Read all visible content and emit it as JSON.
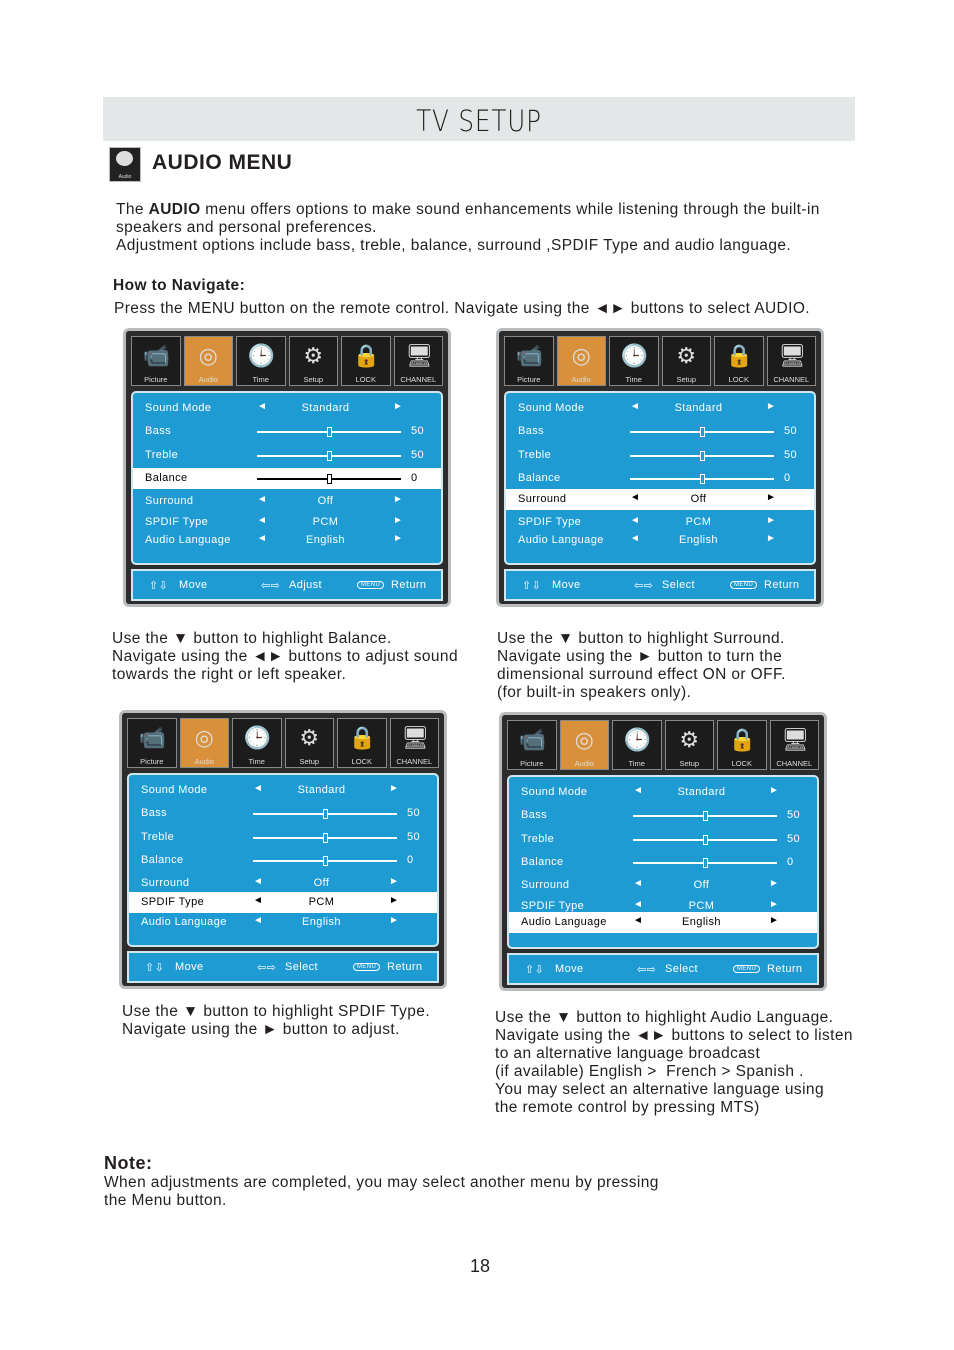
{
  "header": {
    "title": "TV SETUP"
  },
  "section": {
    "icon_label": "Audio",
    "title": "AUDIO MENU"
  },
  "intro": {
    "p1_pre": "The ",
    "p1_bold": "AUDIO",
    "p1_post": " menu offers options to make sound enhancements while listening through the built-in",
    "p1_line2": "speakers and personal preferences.",
    "p2": "Adjustment options include bass, treble, balance, surround ,SPDIF Type and audio language."
  },
  "navigate": {
    "heading": "How to Navigate:",
    "text": "Press the MENU button on the remote control. Navigate using the ◄► buttons to select AUDIO."
  },
  "tabs": [
    {
      "label": "Picture",
      "icon": "camera-icon"
    },
    {
      "label": "Audio",
      "icon": "satellite-dish-icon"
    },
    {
      "label": "Time",
      "icon": "clock-icon"
    },
    {
      "label": "Setup",
      "icon": "gear-icon"
    },
    {
      "label": "LOCK",
      "icon": "lock-icon"
    },
    {
      "label": "CHANNEL",
      "icon": "monitor-icon"
    }
  ],
  "rows": {
    "sound_mode": "Sound Mode",
    "bass": "Bass",
    "treble": "Treble",
    "balance": "Balance",
    "surround": "Surround",
    "spdif": "SPDIF Type",
    "language": "Audio Language"
  },
  "values": {
    "sound_mode": "Standard",
    "bass": "50",
    "treble": "50",
    "balance": "0",
    "surround": "Off",
    "spdif": "PCM",
    "language": "English"
  },
  "slider_levels": {
    "bass": 50,
    "treble": 50,
    "balance": 0
  },
  "footer": {
    "move": "Move",
    "menu": "MENU",
    "return": "Return"
  },
  "panels": [
    {
      "highlight": "balance",
      "adjust_label": "Adjust",
      "caption": [
        "Use the ▼ button to highlight Balance.",
        "Navigate using the ◄► buttons to adjust sound",
        "towards the right or left speaker."
      ]
    },
    {
      "highlight": "surround",
      "adjust_label": "Select",
      "caption": [
        "Use the ▼ button to highlight Surround.",
        "Navigate using the ► button to turn the",
        "dimensional surround effect ON or OFF.",
        "(for built-in speakers only)."
      ]
    },
    {
      "highlight": "spdif",
      "adjust_label": "Select",
      "caption": [
        "Use the ▼ button to highlight SPDIF Type.",
        "Navigate using the ► button to adjust."
      ]
    },
    {
      "highlight": "language",
      "adjust_label": "Select",
      "caption": [
        "Use the ▼ button to highlight Audio Language.",
        "Navigate using the ◄► buttons to select to listen",
        "to an alternative language broadcast",
        "(if available) English >  French > Spanish .",
        "You may select an alternative language using",
        "the remote control by pressing MTS)"
      ]
    }
  ],
  "note": {
    "heading": "Note:",
    "line1": "When adjustments are completed, you may select another menu by pressing",
    "line2": "the Menu button."
  },
  "page_number": "18",
  "colors": {
    "menu_blue": "#1f9bd3",
    "active_tab": "#d8913a",
    "header_bg": "#e4e7e8"
  }
}
